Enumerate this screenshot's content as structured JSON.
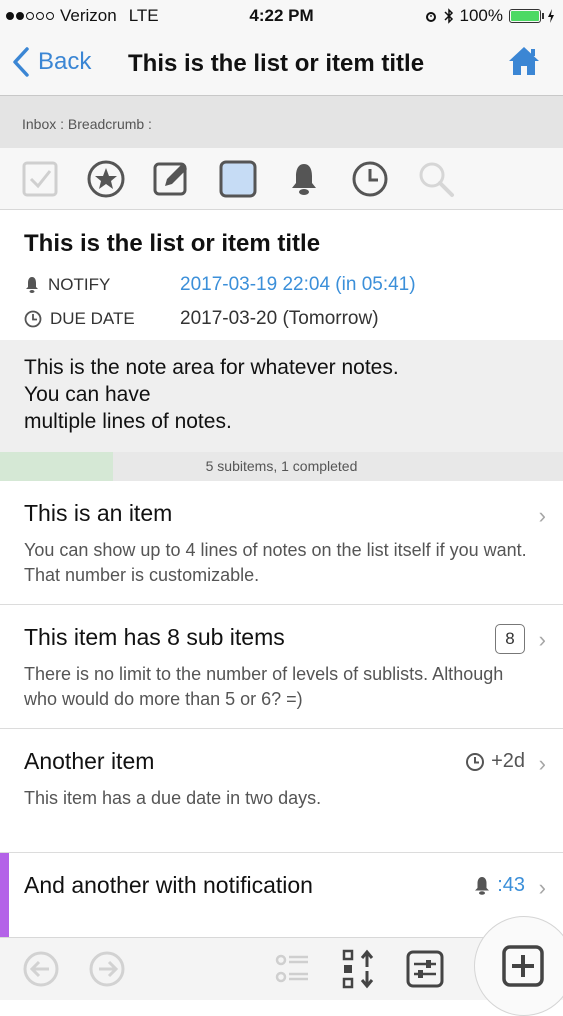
{
  "status": {
    "carrier": "Verizon",
    "network": "LTE",
    "time": "4:22 PM",
    "battery": "100%"
  },
  "nav": {
    "back_label": "Back",
    "title": "This is the list or item title"
  },
  "breadcrumb": "Inbox : Breadcrumb :",
  "toolbar": [
    "checkbox-icon",
    "star-icon",
    "edit-icon",
    "color-square-icon",
    "bell-icon",
    "clock-icon",
    "search-icon"
  ],
  "detail": {
    "title": "This is the list or item title",
    "notify_label": "NOTIFY",
    "notify_value": "2017-03-19 22:04 (in 05:41)",
    "due_label": "DUE DATE",
    "due_value": "2017-03-20 (Tomorrow)"
  },
  "notes": [
    "This is the note area for whatever notes.",
    "You can have",
    "multiple lines of notes."
  ],
  "progress": {
    "text": "5 subitems, 1 completed",
    "fraction": 0.2
  },
  "items": [
    {
      "title": "This is an item",
      "note": "You can show up to 4 lines of notes on the list itself if you want. That number is customizable."
    },
    {
      "title": "This item has 8 sub items",
      "badge": "8",
      "note": "There is no limit to the number of levels of sublists. Although who would do more than 5 or 6? =)"
    },
    {
      "title": "Another item",
      "meta": "+2d",
      "note": "This item has a due date in two days."
    },
    {
      "title": "And another with notification",
      "meta": ":43"
    }
  ],
  "colors": {
    "accent": "#3b86d4",
    "purple": "#b462e8",
    "progress": "#d5e8d5"
  },
  "chevron": "›"
}
